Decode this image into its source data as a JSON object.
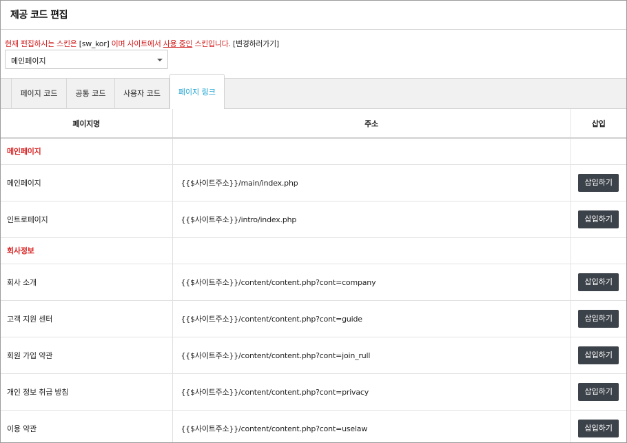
{
  "header": {
    "title": "제공 코드 편집"
  },
  "notice": {
    "part1": "현재 편집하시는 스킨은 ",
    "skin_code": "[sw_kor]",
    "part2": " 이며 사이트에서 ",
    "in_use": "사용 중인",
    "part3": " 스킨입니다. ",
    "change_link": "[변경하러가기]"
  },
  "skin_select": {
    "selected": "메인페이지"
  },
  "tabs": [
    {
      "label": "페이지 코드",
      "active": false
    },
    {
      "label": "공통 코드",
      "active": false
    },
    {
      "label": "사용자 코드",
      "active": false
    },
    {
      "label": "페이지 링크",
      "active": true
    }
  ],
  "table": {
    "columns": [
      "페이지명",
      "주소",
      "삽입"
    ],
    "insert_label": "삽입하기",
    "groups": [
      {
        "title": "메인페이지",
        "rows": [
          {
            "name": "메인페이지",
            "address": "{{$사이트주소}}/main/index.php"
          },
          {
            "name": "인트로페이지",
            "address": "{{$사이트주소}}/intro/index.php"
          }
        ]
      },
      {
        "title": "회사정보",
        "rows": [
          {
            "name": "회사 소개",
            "address": "{{$사이트주소}}/content/content.php?cont=company"
          },
          {
            "name": "고객 지원 센터",
            "address": "{{$사이트주소}}/content/content.php?cont=guide"
          },
          {
            "name": "회원 가입 약관",
            "address": "{{$사이트주소}}/content/content.php?cont=join_rull"
          },
          {
            "name": "개인 정보 취급 방침",
            "address": "{{$사이트주소}}/content/content.php?cont=privacy"
          },
          {
            "name": "이용 약관",
            "address": "{{$사이트주소}}/content/content.php?cont=uselaw"
          }
        ]
      }
    ]
  },
  "colors": {
    "accent_red": "#d21b1b",
    "active_tab": "#1aa3d2",
    "button_bg": "#3c424a"
  }
}
